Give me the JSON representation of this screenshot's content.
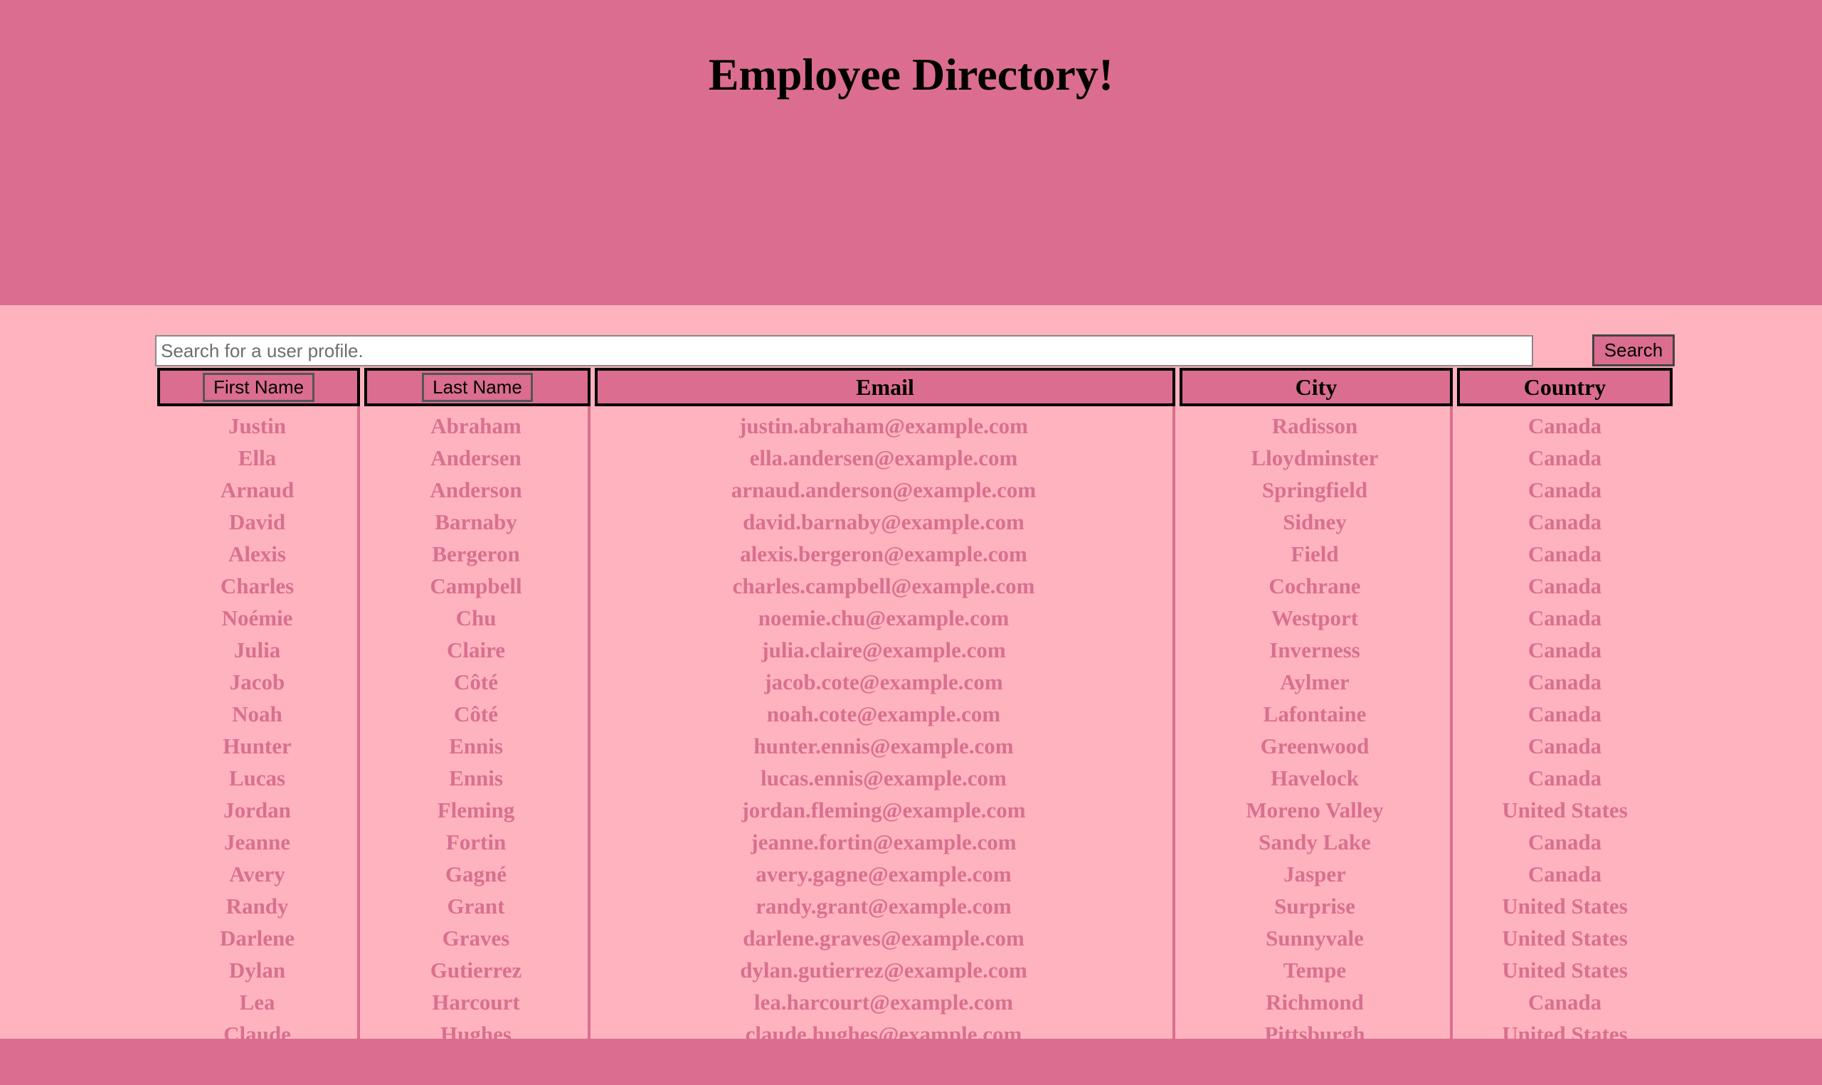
{
  "page": {
    "title": "Employee Directory!",
    "colors": {
      "header": "#db6d90",
      "body": "#ffb3be",
      "row_text": "#d87090"
    }
  },
  "search": {
    "placeholder": "Search for a user profile.",
    "button_label": "Search"
  },
  "table": {
    "columns": {
      "first_name": "First Name",
      "last_name": "Last Name",
      "email": "Email",
      "city": "City",
      "country": "Country"
    },
    "rows": [
      {
        "first": "Justin",
        "last": "Abraham",
        "email": "justin.abraham@example.com",
        "city": "Radisson",
        "country": "Canada"
      },
      {
        "first": "Ella",
        "last": "Andersen",
        "email": "ella.andersen@example.com",
        "city": "Lloydminster",
        "country": "Canada"
      },
      {
        "first": "Arnaud",
        "last": "Anderson",
        "email": "arnaud.anderson@example.com",
        "city": "Springfield",
        "country": "Canada"
      },
      {
        "first": "David",
        "last": "Barnaby",
        "email": "david.barnaby@example.com",
        "city": "Sidney",
        "country": "Canada"
      },
      {
        "first": "Alexis",
        "last": "Bergeron",
        "email": "alexis.bergeron@example.com",
        "city": "Field",
        "country": "Canada"
      },
      {
        "first": "Charles",
        "last": "Campbell",
        "email": "charles.campbell@example.com",
        "city": "Cochrane",
        "country": "Canada"
      },
      {
        "first": "Noémie",
        "last": "Chu",
        "email": "noemie.chu@example.com",
        "city": "Westport",
        "country": "Canada"
      },
      {
        "first": "Julia",
        "last": "Claire",
        "email": "julia.claire@example.com",
        "city": "Inverness",
        "country": "Canada"
      },
      {
        "first": "Jacob",
        "last": "Côté",
        "email": "jacob.cote@example.com",
        "city": "Aylmer",
        "country": "Canada"
      },
      {
        "first": "Noah",
        "last": "Côté",
        "email": "noah.cote@example.com",
        "city": "Lafontaine",
        "country": "Canada"
      },
      {
        "first": "Hunter",
        "last": "Ennis",
        "email": "hunter.ennis@example.com",
        "city": "Greenwood",
        "country": "Canada"
      },
      {
        "first": "Lucas",
        "last": "Ennis",
        "email": "lucas.ennis@example.com",
        "city": "Havelock",
        "country": "Canada"
      },
      {
        "first": "Jordan",
        "last": "Fleming",
        "email": "jordan.fleming@example.com",
        "city": "Moreno Valley",
        "country": "United States"
      },
      {
        "first": "Jeanne",
        "last": "Fortin",
        "email": "jeanne.fortin@example.com",
        "city": "Sandy Lake",
        "country": "Canada"
      },
      {
        "first": "Avery",
        "last": "Gagné",
        "email": "avery.gagne@example.com",
        "city": "Jasper",
        "country": "Canada"
      },
      {
        "first": "Randy",
        "last": "Grant",
        "email": "randy.grant@example.com",
        "city": "Surprise",
        "country": "United States"
      },
      {
        "first": "Darlene",
        "last": "Graves",
        "email": "darlene.graves@example.com",
        "city": "Sunnyvale",
        "country": "United States"
      },
      {
        "first": "Dylan",
        "last": "Gutierrez",
        "email": "dylan.gutierrez@example.com",
        "city": "Tempe",
        "country": "United States"
      },
      {
        "first": "Lea",
        "last": "Harcourt",
        "email": "lea.harcourt@example.com",
        "city": "Richmond",
        "country": "Canada"
      },
      {
        "first": "Claude",
        "last": "Hughes",
        "email": "claude.hughes@example.com",
        "city": "Pittsburgh",
        "country": "United States"
      }
    ]
  }
}
